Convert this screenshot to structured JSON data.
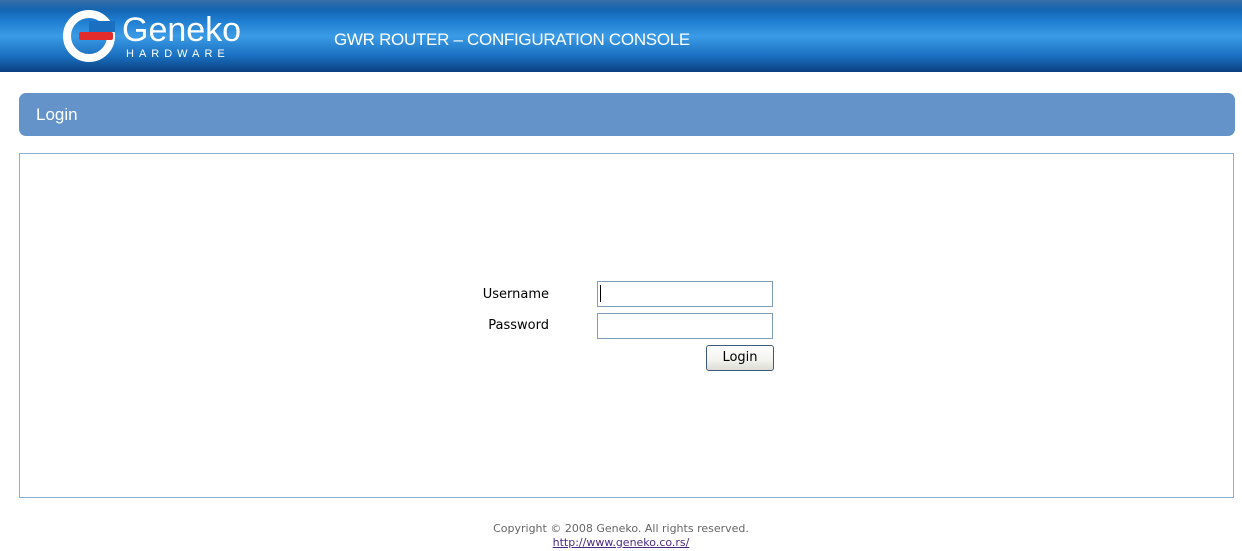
{
  "header": {
    "logo_word": "Geneko",
    "logo_sub": "HARDWARE",
    "title": "GWR ROUTER – CONFIGURATION CONSOLE"
  },
  "section": {
    "title": "Login"
  },
  "form": {
    "username_label": "Username",
    "username_value": "",
    "password_label": "Password",
    "password_value": "",
    "login_label": "Login"
  },
  "footer": {
    "copyright": "Copyright © 2008 Geneko. All rights reserved.",
    "link": "http://www.geneko.co.rs/"
  },
  "colors": {
    "banner_blue": "#1e7ccf",
    "section_header": "#6393c9",
    "logo_red": "#e32b2b",
    "panel_border": "#8fb0cf",
    "link": "#4a2a86"
  },
  "icons": {
    "logo_mark": "geneko-logo-icon"
  }
}
